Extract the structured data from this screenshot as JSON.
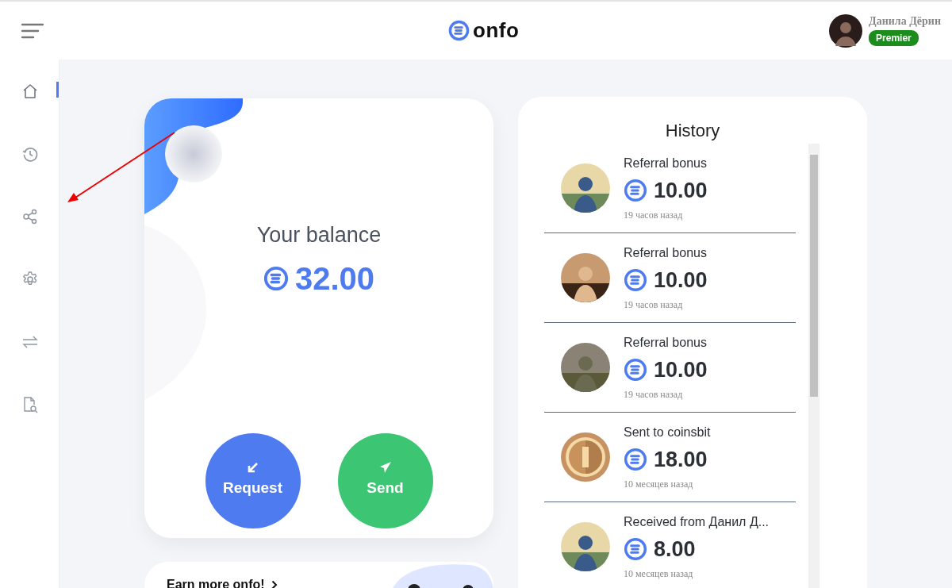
{
  "header": {
    "logo": "onfo",
    "user": {
      "name": "Данила Дёрин",
      "badge": "Premier"
    }
  },
  "sidebar": {
    "items": [
      {
        "kind": "home",
        "selected": true
      },
      {
        "kind": "history",
        "selected": false
      },
      {
        "kind": "share",
        "selected": false
      },
      {
        "kind": "settings",
        "selected": false
      },
      {
        "kind": "exchange",
        "selected": false
      },
      {
        "kind": "document",
        "selected": false
      }
    ]
  },
  "balance": {
    "title": "Your balance",
    "amount": "32.00",
    "actions": [
      {
        "kind": "request",
        "label": "Request"
      },
      {
        "kind": "send",
        "label": "Send"
      }
    ]
  },
  "promo": {
    "title": "Earn more onfo!"
  },
  "history": {
    "title": "History",
    "items": [
      {
        "title": "Referral bonus",
        "amount": "10.00",
        "time": "19 часов назад"
      },
      {
        "title": "Referral bonus",
        "amount": "10.00",
        "time": "19 часов назад"
      },
      {
        "title": "Referral bonus",
        "amount": "10.00",
        "time": "19 часов назад"
      },
      {
        "title": "Sent to coinsbit",
        "amount": "18.00",
        "time": "10 месяцев назад",
        "kind": "coin"
      },
      {
        "title": "Received from Данил Д...",
        "amount": "8.00",
        "time": "10 месяцев назад"
      }
    ]
  }
}
